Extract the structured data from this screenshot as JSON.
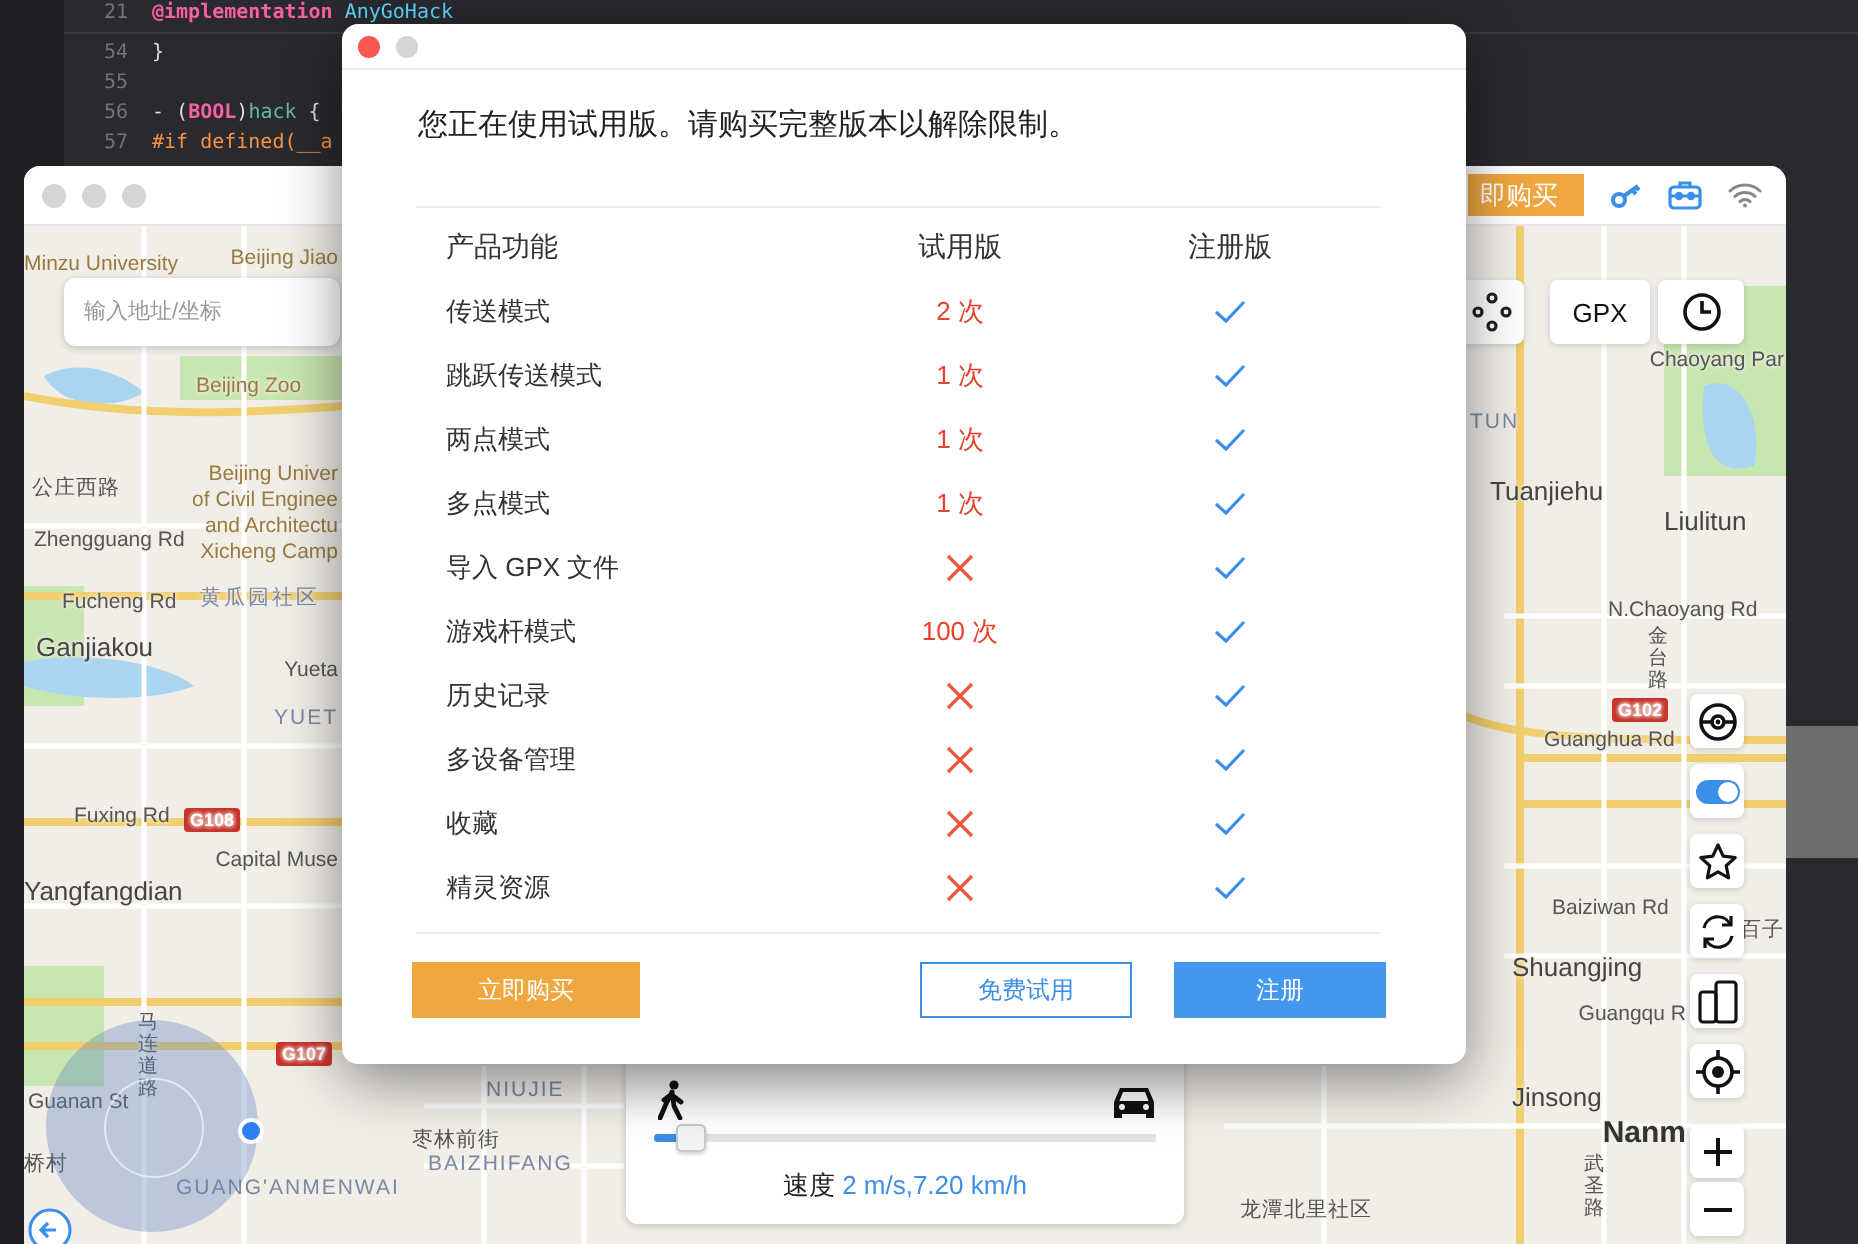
{
  "editor": {
    "lines": [
      {
        "number": "21",
        "tokens": [
          {
            "text": "@implementation",
            "kind": "keyword"
          },
          {
            "text": " AnyGoHack",
            "kind": "type"
          }
        ]
      },
      {
        "number": "54",
        "tokens": [
          {
            "text": "}",
            "kind": "plain"
          }
        ]
      },
      {
        "number": "55"
      },
      {
        "number": "56",
        "tokens": [
          {
            "text": "- (",
            "kind": "plain"
          },
          {
            "text": "BOOL",
            "kind": "keyword"
          },
          {
            "text": ")",
            "kind": "plain"
          },
          {
            "text": "hack",
            "kind": "method"
          },
          {
            "text": " {",
            "kind": "plain"
          }
        ]
      },
      {
        "number": "57",
        "tokens": [
          {
            "text": "#if defined(__a",
            "kind": "preprocessor"
          }
        ]
      }
    ]
  },
  "map_window": {
    "buy_button": "即购买",
    "search": {
      "placeholder": "输入地址/坐标"
    },
    "gpx_button": "GPX",
    "toggle": {
      "on": true
    },
    "labels": [
      {
        "text": "Minzu University",
        "kind": "poi"
      },
      {
        "text": "Beijing Jiao",
        "kind": "poi"
      },
      {
        "text": "Beijing Zoo",
        "kind": "poi"
      },
      {
        "text": "公庄西路",
        "kind": "road"
      },
      {
        "text": "Beijing Univer",
        "kind": "poi"
      },
      {
        "text": "of Civil Enginee",
        "kind": "poi"
      },
      {
        "text": "and Architectu",
        "kind": "poi"
      },
      {
        "text": "Xicheng Camp",
        "kind": "poi"
      },
      {
        "text": "Zhengguang Rd",
        "kind": "road"
      },
      {
        "text": "Fucheng Rd",
        "kind": "road"
      },
      {
        "text": "黄瓜园社区",
        "kind": "district"
      },
      {
        "text": "Ganjiakou",
        "kind": "place"
      },
      {
        "text": "Yueta",
        "kind": "road"
      },
      {
        "text": "YUET",
        "kind": "district"
      },
      {
        "text": "Fuxing Rd",
        "kind": "road"
      },
      {
        "text": "G108",
        "kind": "shield"
      },
      {
        "text": "Capital Muse",
        "kind": "road"
      },
      {
        "text": "Yangfangdian",
        "kind": "place"
      },
      {
        "text": "G107",
        "kind": "shield"
      },
      {
        "text": "Guanan St",
        "kind": "road"
      },
      {
        "text": "马连道路",
        "kind": "vertical"
      },
      {
        "text": "桥村",
        "kind": "road"
      },
      {
        "text": "GUANG'ANMENWAI",
        "kind": "district"
      },
      {
        "text": "NIUJIE",
        "kind": "district"
      },
      {
        "text": "枣林前街",
        "kind": "road"
      },
      {
        "text": "BAIZHIFANG",
        "kind": "district"
      },
      {
        "text": "龙潭北里社区",
        "kind": "road"
      },
      {
        "text": "Chaoyang Par",
        "kind": "road"
      },
      {
        "text": "TUN",
        "kind": "district"
      },
      {
        "text": "Tuanjiehu",
        "kind": "place"
      },
      {
        "text": "Liulitun",
        "kind": "place"
      },
      {
        "text": "N.Chaoyang Rd",
        "kind": "road"
      },
      {
        "text": "金台路",
        "kind": "vertical"
      },
      {
        "text": "G102",
        "kind": "shield"
      },
      {
        "text": "Guanghua Rd",
        "kind": "road"
      },
      {
        "text": "Baiziwan Rd",
        "kind": "road"
      },
      {
        "text": "百子",
        "kind": "road"
      },
      {
        "text": "Shuangjing",
        "kind": "place"
      },
      {
        "text": "Guangqu R",
        "kind": "road"
      },
      {
        "text": "Jinsong",
        "kind": "place"
      },
      {
        "text": "Nanm",
        "kind": "bold"
      },
      {
        "text": "武圣路",
        "kind": "vertical"
      }
    ]
  },
  "speed_panel": {
    "level": 0.05,
    "label": "速度",
    "reading": "2 m/s,7.20 km/h"
  },
  "dialog": {
    "heading": "您正在使用试用版。请购买完整版本以解除限制。",
    "columns": [
      "产品功能",
      "试用版",
      "注册版"
    ],
    "rows": [
      {
        "feature": "传送模式",
        "trial": {
          "kind": "count",
          "text": "2 次"
        },
        "registered": true
      },
      {
        "feature": "跳跃传送模式",
        "trial": {
          "kind": "count",
          "text": "1 次"
        },
        "registered": true
      },
      {
        "feature": "两点模式",
        "trial": {
          "kind": "count",
          "text": "1 次"
        },
        "registered": true
      },
      {
        "feature": "多点模式",
        "trial": {
          "kind": "count",
          "text": "1 次"
        },
        "registered": true
      },
      {
        "feature": "导入 GPX 文件",
        "trial": {
          "kind": "none"
        },
        "registered": true
      },
      {
        "feature": "游戏杆模式",
        "trial": {
          "kind": "count",
          "text": "100 次"
        },
        "registered": true
      },
      {
        "feature": "历史记录",
        "trial": {
          "kind": "none"
        },
        "registered": true
      },
      {
        "feature": "多设备管理",
        "trial": {
          "kind": "none"
        },
        "registered": true
      },
      {
        "feature": "收藏",
        "trial": {
          "kind": "none"
        },
        "registered": true
      },
      {
        "feature": "精灵资源",
        "trial": {
          "kind": "none"
        },
        "registered": true
      }
    ],
    "buttons": [
      {
        "label": "立即购买",
        "kind": "buy"
      },
      {
        "label": "免费试用",
        "kind": "trial"
      },
      {
        "label": "注册",
        "kind": "register"
      }
    ]
  }
}
